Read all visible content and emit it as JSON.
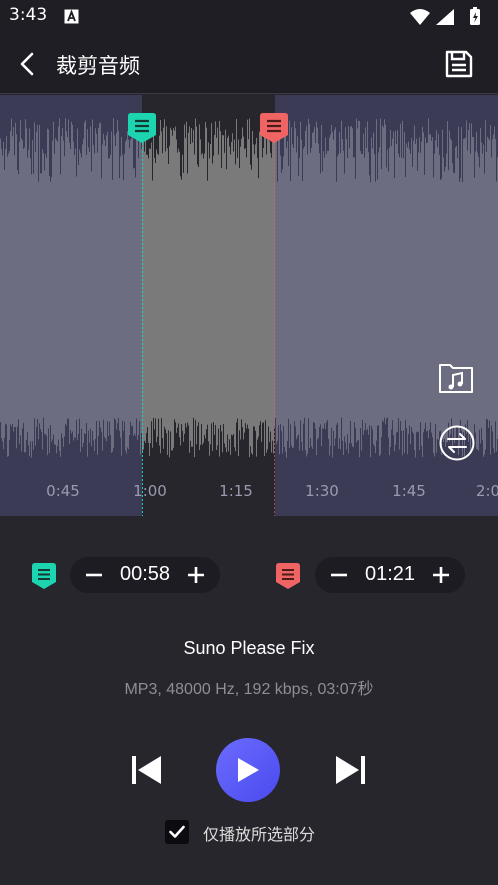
{
  "status_bar": {
    "time": "3:43"
  },
  "app_bar": {
    "title": "裁剪音频"
  },
  "waveform": {
    "tick_labels": [
      "0:45",
      "1:00",
      "1:15",
      "1:30",
      "1:45",
      "2:0"
    ]
  },
  "trim": {
    "start_time": "00:58",
    "end_time": "01:21"
  },
  "track": {
    "title": "Suno Please Fix",
    "meta": "MP3, 48000 Hz, 192 kbps, 03:07秒"
  },
  "options": {
    "play_selected_only_label": "仅播放所选部分",
    "play_selected_only_checked": true
  },
  "colors": {
    "start_marker": "#1dd4b0",
    "end_marker": "#f06464",
    "accent": "#5858f4",
    "wave_bg": "#3b3b55",
    "wave_fill": "#6d6d82",
    "selection_bg": "#26262c",
    "selection_fill": "#7a7a7a"
  }
}
